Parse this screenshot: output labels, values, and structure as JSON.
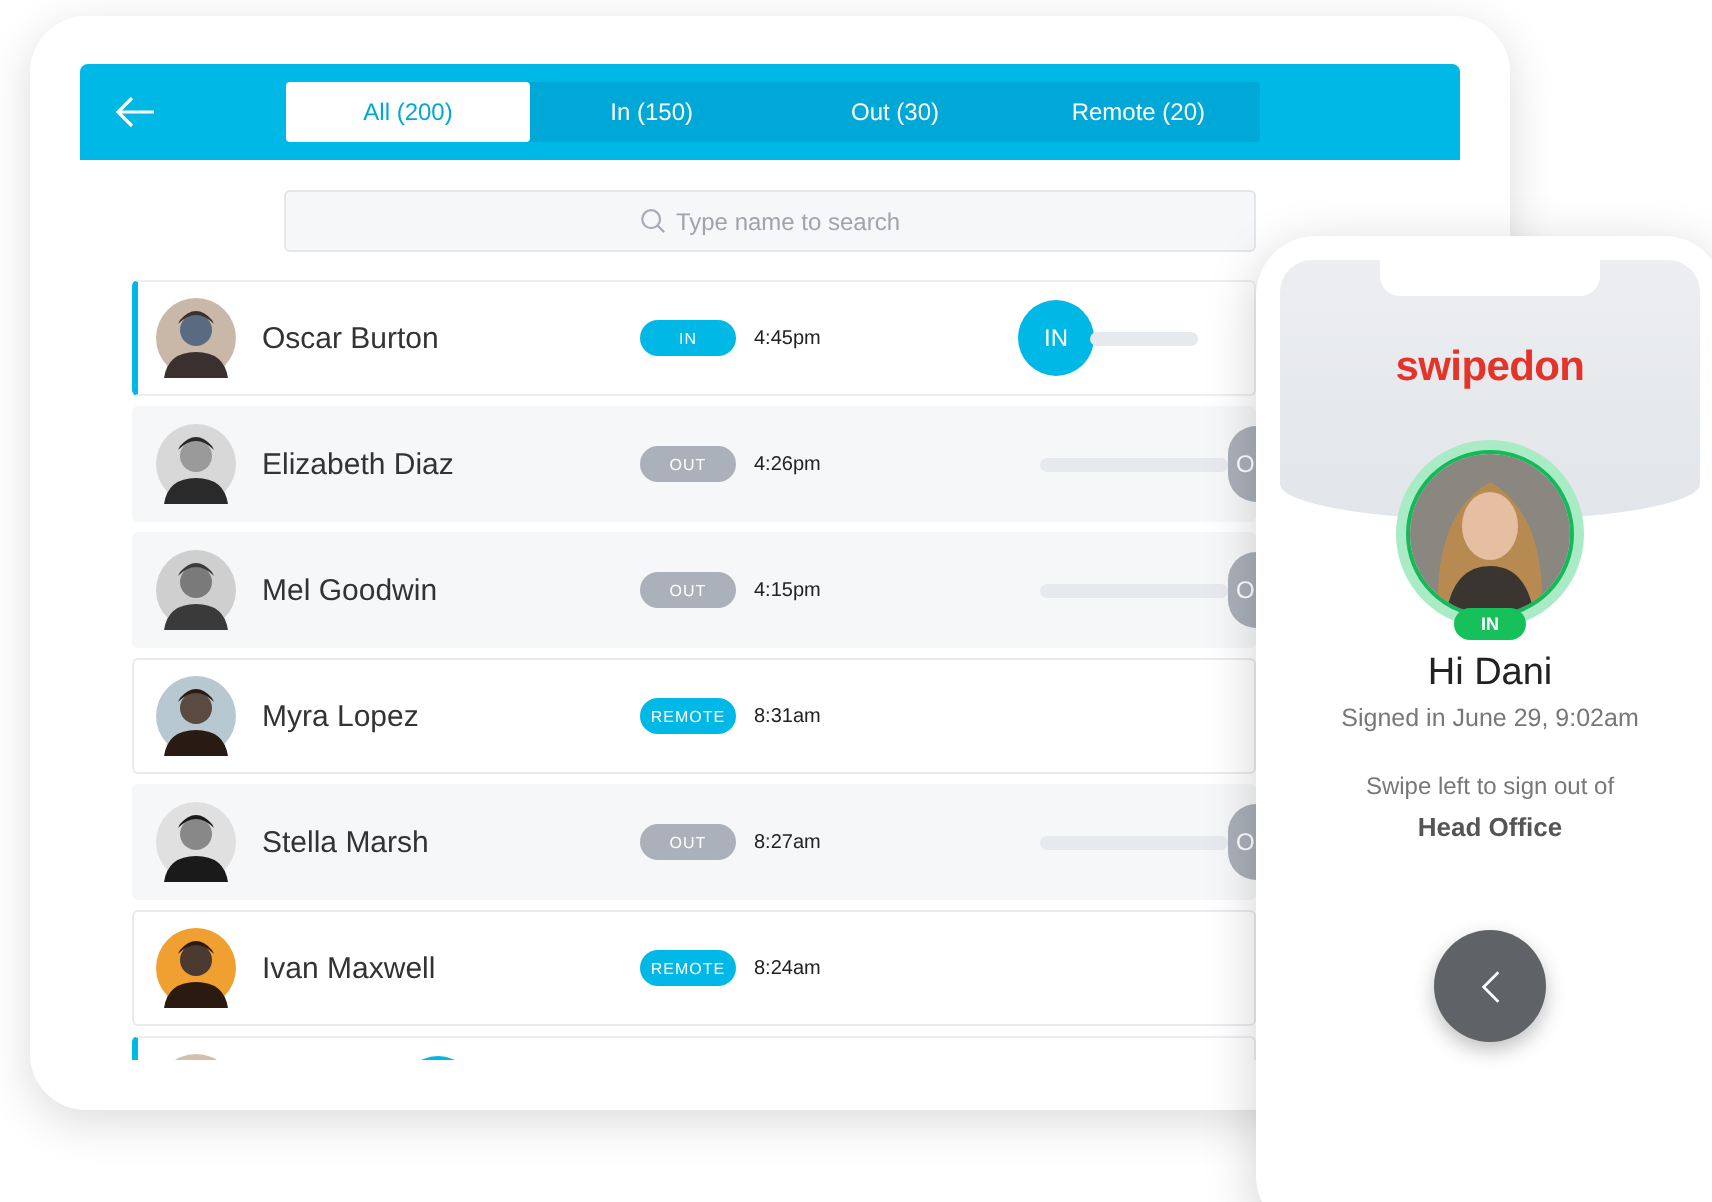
{
  "tablet": {
    "tabs": [
      {
        "label": "All (200)",
        "selected": true
      },
      {
        "label": "In (150)",
        "selected": false
      },
      {
        "label": "Out (30)",
        "selected": false
      },
      {
        "label": "Remote (20)",
        "selected": false
      }
    ],
    "search": {
      "placeholder": "Type name to search"
    },
    "rows": [
      {
        "kind": "in",
        "name": "Oscar Burton",
        "badge": "IN",
        "time": "4:45pm",
        "thumb": "IN"
      },
      {
        "kind": "out",
        "name": "Elizabeth Diaz",
        "badge": "OUT",
        "time": "4:26pm",
        "thumb": "O"
      },
      {
        "kind": "out",
        "name": "Mel Goodwin",
        "badge": "OUT",
        "time": "4:15pm",
        "thumb": "O"
      },
      {
        "kind": "remote",
        "name": "Myra Lopez",
        "badge": "REMOTE",
        "time": "8:31am"
      },
      {
        "kind": "out",
        "name": "Stella Marsh",
        "badge": "OUT",
        "time": "8:27am",
        "thumb": "O"
      },
      {
        "kind": "remote",
        "name": "Ivan Maxwell",
        "badge": "REMOTE",
        "time": "8:24am"
      },
      {
        "kind": "in"
      }
    ]
  },
  "phone": {
    "logo": "swipedon",
    "status_badge": "IN",
    "greeting": "Hi Dani",
    "signed_in": "Signed in June 29, 9:02am",
    "instruction": "Swipe left to sign out of",
    "location": "Head Office"
  }
}
